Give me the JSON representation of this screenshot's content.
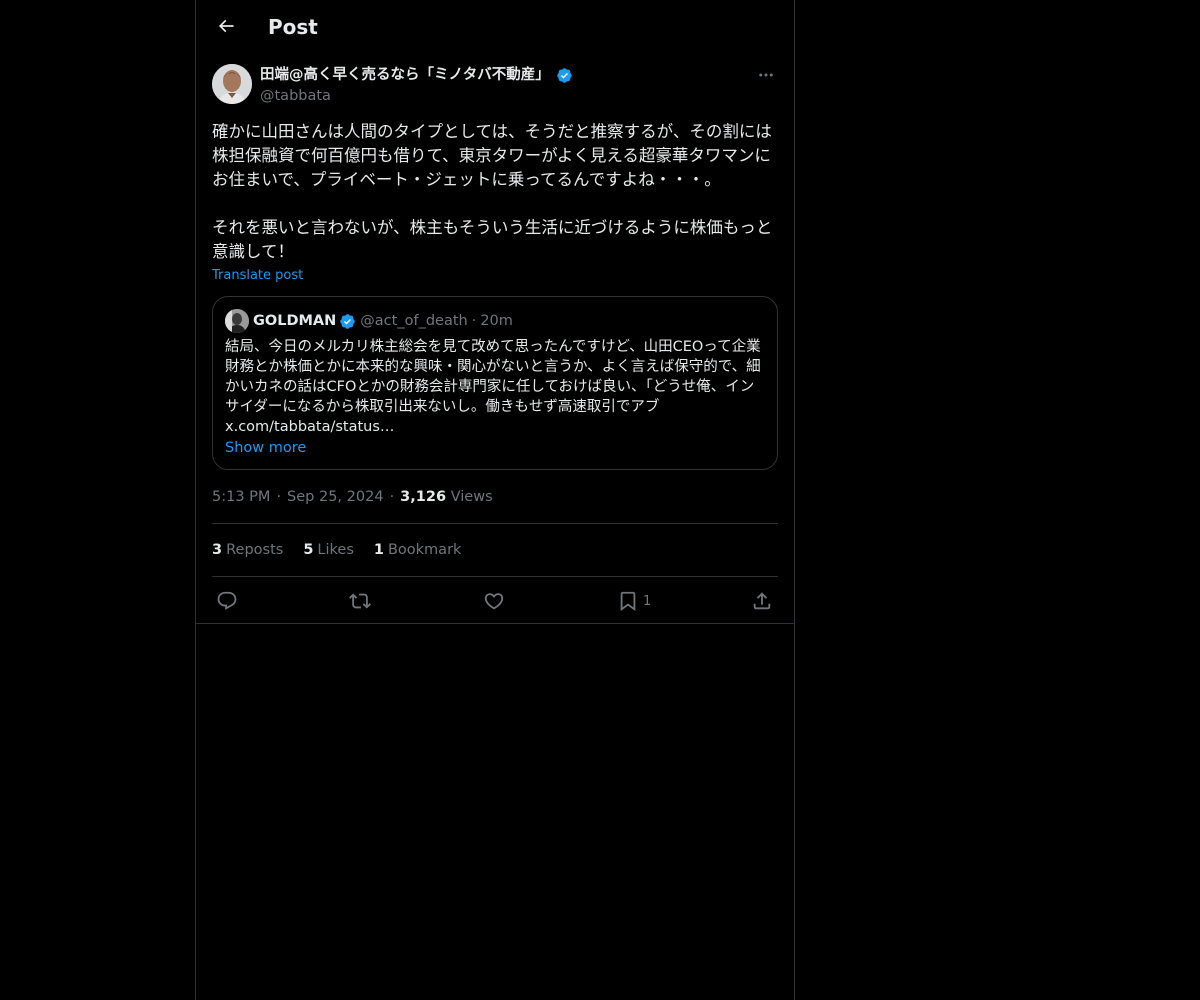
{
  "header": {
    "title": "Post"
  },
  "post": {
    "author_name": "田端@高く早く売るなら「ミノタバ不動産」",
    "author_handle": "@tabbata",
    "text": "確かに山田さんは人間のタイプとしては、そうだと推察するが、その割には株担保融資で何百億円も借りて、東京タワーがよく見える超豪華タワマンにお住まいで、プライベート・ジェットに乗ってるんですよね・・・。\n\nそれを悪いと言わないが、株主もそういう生活に近づけるように株価もっと意識して！",
    "translate_label": "Translate post",
    "quote": {
      "name": "GOLDMAN",
      "handle": "@act_of_death",
      "dot": "·",
      "time": "20m",
      "text": "結局、今日のメルカリ株主総会を見て改めて思ったんですけど、山田CEOって企業財務とか株価とかに本来的な興味・関心がないと言うか、よく言えば保守的で、細かいカネの話はCFOとかの財務会計専門家に任しておけば良い、「どうせ俺、インサイダーになるから株取引出来ないし。働きもせず高速取引でアブ\nx.com/tabbata/status…",
      "show_more": "Show more"
    },
    "time": "5:13 PM",
    "date": "Sep 25, 2024",
    "views_count": "3,126",
    "views_label": "Views",
    "meta_sep": "·",
    "stats": {
      "reposts_count": "3",
      "reposts_label": "Reposts",
      "likes_count": "5",
      "likes_label": "Likes",
      "bookmarks_count": "1",
      "bookmarks_label": "Bookmark"
    },
    "actions": {
      "bookmark_count": "1"
    }
  },
  "colors": {
    "background": "#000000",
    "text": "#e7e9ea",
    "secondary": "#71767b",
    "accent": "#1d9bf0",
    "border": "#2f3336",
    "verified": "#1d9bf0"
  },
  "icons": [
    "back-arrow-icon",
    "verified-badge-icon",
    "more-icon",
    "reply-icon",
    "repost-icon",
    "like-icon",
    "bookmark-icon",
    "share-icon"
  ]
}
